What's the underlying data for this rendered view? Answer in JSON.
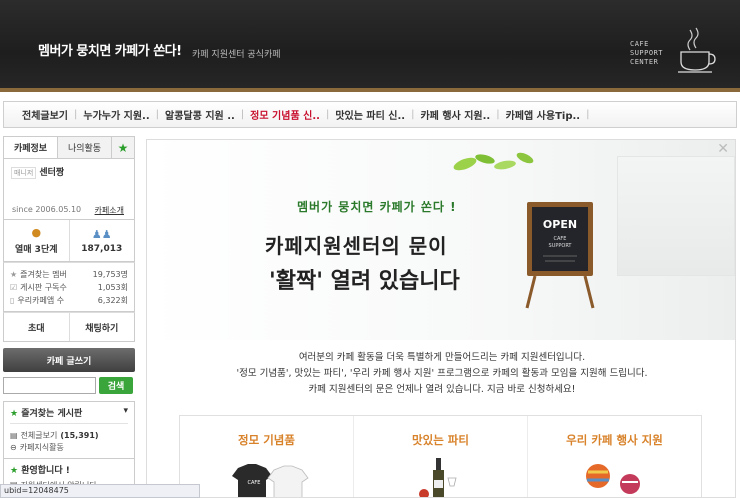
{
  "header": {
    "slogan": "멤버가 뭉치면 카페가 쏜다!",
    "subtitle": "카페 지원센터 공식카페",
    "logo_lines": [
      "CAFE",
      "SUPPORT",
      "CENTER"
    ]
  },
  "topnav": {
    "items": [
      {
        "label": "전체글보기"
      },
      {
        "label": "누가누가 지원.."
      },
      {
        "label": "알콩달콩 지원 .."
      },
      {
        "label": "정모 기념품 신.."
      },
      {
        "label": "맛있는 파티 신.."
      },
      {
        "label": "카페 행사 지원.."
      },
      {
        "label": "카페앱 사용Tip.."
      }
    ]
  },
  "sidebar": {
    "tabs": [
      "카페정보",
      "나의활동"
    ],
    "manager_badge": "매니저",
    "manager_name": "센터짱",
    "since": "since 2006.05.10",
    "intro_link": "카페소개",
    "level": "열매 3단계",
    "members": "187,013",
    "counts": [
      {
        "label": "즐겨찾는 멤버",
        "value": "19,753명",
        "icon": "star-icon"
      },
      {
        "label": "게시판 구독수",
        "value": "1,053회",
        "icon": "check-icon"
      },
      {
        "label": "우리카페앱 수",
        "value": "6,322회",
        "icon": "phone-icon"
      }
    ],
    "invite": "초대",
    "chat": "채팅하기",
    "write": "카페 글쓰기",
    "search_button": "검색",
    "favorites": {
      "title": "즐겨찾는 게시판",
      "items": [
        {
          "label": "전체글보기",
          "count": "(15,391)"
        },
        {
          "label": "카페지식활동",
          "count": ""
        }
      ]
    },
    "welcome": {
      "title": "환영합니다 !",
      "item": "지원센터에서 알립니다"
    }
  },
  "main": {
    "small_headline": "멤버가 뭉치면 카페가 쏜다 !",
    "headline1": "카페지원센터의 문이",
    "headline2": "'활짝' 열려 있습니다",
    "board": {
      "title": "OPEN",
      "line1": "CAFE",
      "line2": "SUPPORT"
    },
    "desc": [
      "여러분의 카페 활동을 더욱 특별하게 만들어드리는 카페 지원센터입니다.",
      "'정모 기념품', 맛있는 파티', '우리 카페 행사 지원' 프로그램으로 카페의 활동과 모임을 지원해 드립니다.",
      "카페 지원센터의 문은 언제나 열려 있습니다. 지금 바로 신청하세요!"
    ],
    "cards": [
      {
        "title": "정모 기념품",
        "shirt_text": "CAFE"
      },
      {
        "title": "맛있는 파티"
      },
      {
        "title": "우리 카페 행사 지원"
      }
    ]
  },
  "statusbar": "ubid=12048475",
  "colors": {
    "accent_green": "#3aa53a",
    "active_red": "#c8102e",
    "card_title_orange": "#d8822a"
  }
}
